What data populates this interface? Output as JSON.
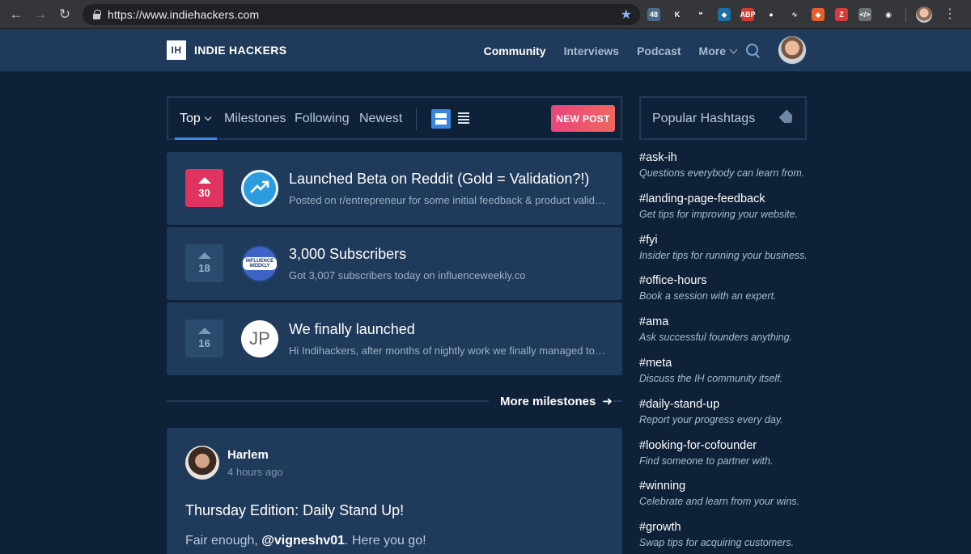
{
  "browser": {
    "url": "https://www.indiehackers.com",
    "extensions": [
      {
        "label": "48",
        "color": "#4a6b8c"
      },
      {
        "label": "K",
        "color": "#35363a"
      },
      {
        "label": "❝",
        "color": "#35363a"
      },
      {
        "label": "◆",
        "color": "#1b6fa3"
      },
      {
        "label": "ABP",
        "color": "#d23a2c"
      },
      {
        "label": "●",
        "color": "#35363a"
      },
      {
        "label": "∿",
        "color": "#35363a"
      },
      {
        "label": "◆",
        "color": "#e85d2c"
      },
      {
        "label": "Z",
        "color": "#d83a3a"
      },
      {
        "label": "</>",
        "color": "#6f7378"
      },
      {
        "label": "◉",
        "color": "#35363a"
      }
    ]
  },
  "site": {
    "logo_mark": "IH",
    "logo_text": "INDIE HACKERS",
    "nav": [
      "Community",
      "Interviews",
      "Podcast",
      "More"
    ]
  },
  "feed": {
    "tabs": [
      "Top",
      "Milestones",
      "Following",
      "Newest"
    ],
    "new_post": "NEW POST",
    "more_milestones": "More milestones",
    "posts": [
      {
        "votes": "30",
        "title": "Launched Beta on Reddit (Gold = Validation?!)",
        "subtitle": "Posted on r/entrepreneur for some initial feedback & product validation and got some really great responses",
        "avatar": "chart"
      },
      {
        "votes": "18",
        "title": "3,000 Subscribers",
        "subtitle": "Got 3,007 subscribers today on influenceweekly.co",
        "avatar": "influence",
        "avatar_text": "INFLUENCE WEEKLY"
      },
      {
        "votes": "16",
        "title": "We finally launched",
        "subtitle": "Hi Indihackers, after months of nightly work we finally managed to launch",
        "avatar": "jp",
        "avatar_text": "JP"
      }
    ]
  },
  "discussion": {
    "author": "Harlem",
    "time": "4 hours ago",
    "title": "Thursday Edition: Daily Stand Up!",
    "body_prefix": "Fair enough, ",
    "mention": "@vigneshv01",
    "body_suffix": ". Here you go!"
  },
  "sidebar": {
    "title": "Popular Hashtags",
    "hashtags": [
      {
        "name": "#ask-ih",
        "desc": "Questions everybody can learn from."
      },
      {
        "name": "#landing-page-feedback",
        "desc": "Get tips for improving your website."
      },
      {
        "name": "#fyi",
        "desc": "Insider tips for running your business."
      },
      {
        "name": "#office-hours",
        "desc": "Book a session with an expert."
      },
      {
        "name": "#ama",
        "desc": "Ask successful founders anything."
      },
      {
        "name": "#meta",
        "desc": "Discuss the IH community itself."
      },
      {
        "name": "#daily-stand-up",
        "desc": "Report your progress every day."
      },
      {
        "name": "#looking-for-cofounder",
        "desc": "Find someone to partner with."
      },
      {
        "name": "#winning",
        "desc": "Celebrate and learn from your wins."
      },
      {
        "name": "#growth",
        "desc": "Swap tips for acquiring customers."
      }
    ]
  }
}
